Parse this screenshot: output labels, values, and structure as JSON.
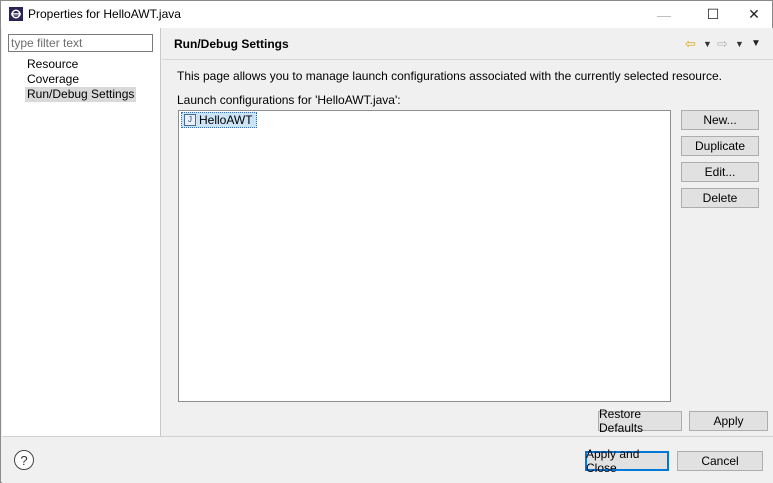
{
  "window": {
    "title": "Properties for HelloAWT.java",
    "minimize_glyph": "—",
    "maximize_glyph": "☐",
    "close_glyph": "✕"
  },
  "sidebar": {
    "filter_placeholder": "type filter text",
    "items": [
      {
        "label": "Resource"
      },
      {
        "label": "Coverage"
      },
      {
        "label": "Run/Debug Settings",
        "selected": true
      }
    ]
  },
  "page": {
    "title": "Run/Debug Settings",
    "description": "This page allows you to manage launch configurations associated with the currently selected resource.",
    "list_label": "Launch configurations for 'HelloAWT.java':",
    "configurations": [
      {
        "label": "HelloAWT",
        "icon": "java-app-launch-icon"
      }
    ],
    "nav": {
      "back_glyph": "⇦",
      "forward_glyph": "⇨",
      "dropdown_glyph": "▼",
      "menu_glyph": "▼"
    }
  },
  "buttons": {
    "new": "New...",
    "duplicate": "Duplicate",
    "edit": "Edit...",
    "delete": "Delete",
    "restore_defaults": "Restore Defaults",
    "apply": "Apply",
    "apply_and_close": "Apply and Close",
    "cancel": "Cancel"
  },
  "footer": {
    "help_glyph": "?"
  },
  "colors": {
    "accent": "#0078d7",
    "selection": "#cce4f7",
    "sidebar_selected": "#d9d9d9",
    "back_arrow": "#d9a420"
  }
}
